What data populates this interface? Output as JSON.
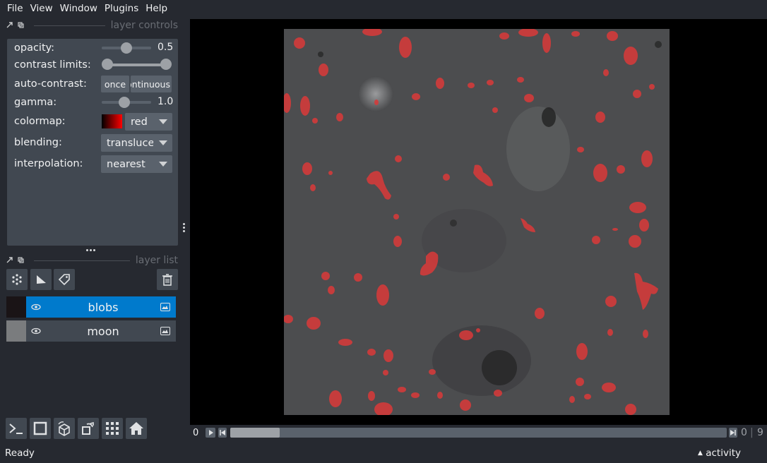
{
  "menubar": {
    "items": [
      "File",
      "View",
      "Window",
      "Plugins",
      "Help"
    ]
  },
  "layer_controls": {
    "title": "layer controls",
    "opacity": {
      "label": "opacity:",
      "value": 0.5,
      "display": "0.5"
    },
    "contrast_limits": {
      "label": "contrast limits:",
      "range": [
        0,
        1
      ]
    },
    "auto_contrast": {
      "label": "auto-contrast:",
      "once_label": "once",
      "continuous_label": "continuous"
    },
    "gamma": {
      "label": "gamma:",
      "value": 1.0,
      "display": "1.0"
    },
    "colormap": {
      "label": "colormap:",
      "value": "red"
    },
    "blending": {
      "label": "blending:",
      "value": "translucent"
    },
    "interpolation": {
      "label": "interpolation:",
      "value": "nearest"
    }
  },
  "layer_list": {
    "title": "layer list",
    "layers": [
      {
        "name": "blobs",
        "selected": true,
        "visible": true
      },
      {
        "name": "moon",
        "selected": false,
        "visible": true
      }
    ]
  },
  "dims": {
    "current_frame": "0",
    "current_index": "0",
    "max_index": "9",
    "slider_position": 0.0
  },
  "status": {
    "text": "Ready",
    "activity_label": "activity"
  },
  "colors": {
    "background": "#262930",
    "panel": "#414851",
    "accent": "#007acc",
    "blob_red": "#d63a3a"
  }
}
